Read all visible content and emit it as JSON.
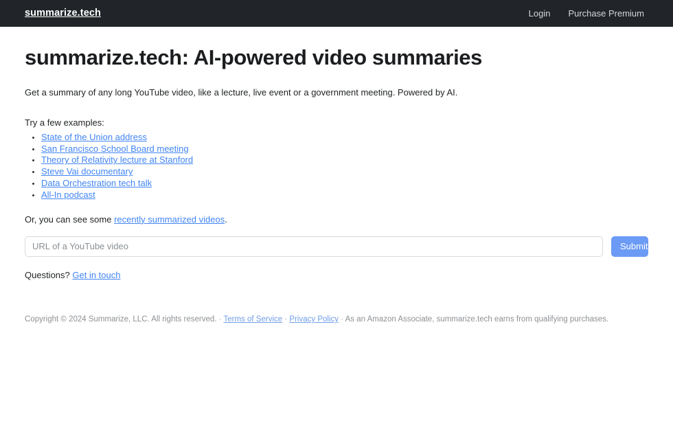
{
  "navbar": {
    "brand": "summarize.tech",
    "links": [
      {
        "label": "Login",
        "name": "nav-link-login"
      },
      {
        "label": "Purchase Premium",
        "name": "nav-link-purchase-premium"
      }
    ]
  },
  "main": {
    "title": "summarize.tech: AI-powered video summaries",
    "lede": "Get a summary of any long YouTube video, like a lecture, live event or a government meeting. Powered by AI.",
    "examples_intro": "Try a few examples:",
    "examples": [
      "State of the Union address",
      "San Francisco School Board meeting",
      "Theory of Relativity lecture at Stanford",
      "Steve Vai documentary",
      "Data Orchestration tech talk",
      "All-In podcast"
    ],
    "recent_prefix": "Or, you can see some ",
    "recent_link": "recently summarized videos",
    "recent_suffix": ".",
    "questions_prefix": "Questions? ",
    "questions_link": "Get in touch"
  },
  "form": {
    "placeholder": "URL of a YouTube video",
    "value": "",
    "submit_label": "Submit"
  },
  "footer": {
    "copyright": "Copyright © 2024 Summarize, LLC. All rights reserved.",
    "sep1": "·",
    "terms_label": "Terms of Service",
    "sep2": "·",
    "privacy_label": "Privacy Policy",
    "sep3": "·",
    "affiliate": "As an Amazon Associate, summarize.tech earns from qualifying purchases."
  },
  "colors": {
    "navbar_bg": "#212529",
    "link_blue": "#4285f4",
    "submit_blue": "#6c9bf5",
    "footer_text": "#8c9094"
  }
}
